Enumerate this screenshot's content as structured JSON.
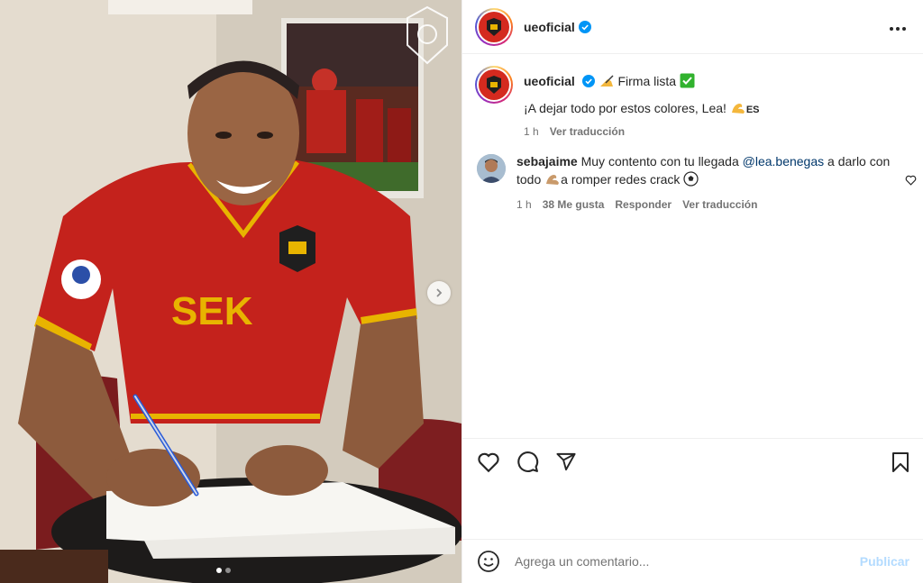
{
  "post": {
    "author": "ueoficial",
    "verified": true,
    "more_icon": "more-horizontal-icon"
  },
  "caption": {
    "author": "ueoficial",
    "title_text": "Firma lista",
    "body": "¡A dejar todo por estos colores, Lea!",
    "language_tag": "ES",
    "time": "1 h",
    "translate": "Ver traducción"
  },
  "comments": [
    {
      "author": "sebajaime",
      "text_before": "Muy contento con tu llegada",
      "mention": "@lea.benegas",
      "text_after": "a darlo con todo",
      "text_end": "a romper redes crack",
      "time": "1 h",
      "likes": "38 Me gusta",
      "reply": "Responder",
      "translate": "Ver traducción"
    }
  ],
  "carousel": {
    "slides": 2,
    "current": 1
  },
  "composer": {
    "placeholder": "Agrega un comentario...",
    "publish": "Publicar"
  },
  "colors": {
    "brand_red": "#d42a1f",
    "link_blue": "#00376b",
    "publish_disabled": "#b3dbff",
    "verified_blue": "#0095f6"
  }
}
